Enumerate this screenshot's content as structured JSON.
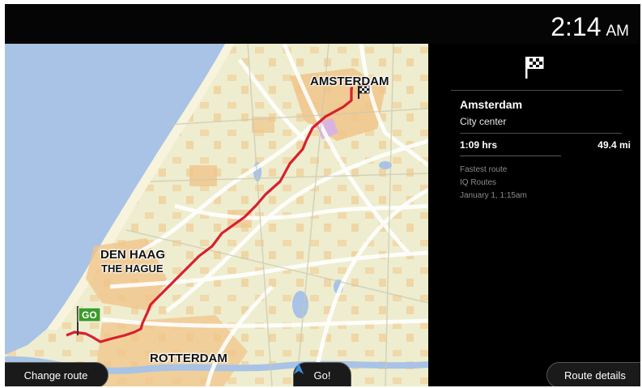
{
  "status_bar": {
    "time": "2:14",
    "ampm": "AM"
  },
  "map": {
    "labels": {
      "amsterdam": "AMSTERDAM",
      "den_haag": "DEN HAAG",
      "the_hague": "THE HAGUE",
      "rotterdam": "ROTTERDAM"
    },
    "start_flag": "GO",
    "route_color": "#d8202e"
  },
  "route_panel": {
    "destination": "Amsterdam",
    "destination_detail": "City center",
    "duration": "1:09 hrs",
    "distance": "49.4 mi",
    "route_type": "Fastest route",
    "routing": "IQ Routes",
    "departure": "January 1,  1:15am"
  },
  "buttons": {
    "change_route": "Change route",
    "go": "Go!",
    "route_details": "Route details"
  },
  "icons": {
    "finish": "checkered-flag-icon",
    "go": "navigation-arrow-icon"
  }
}
